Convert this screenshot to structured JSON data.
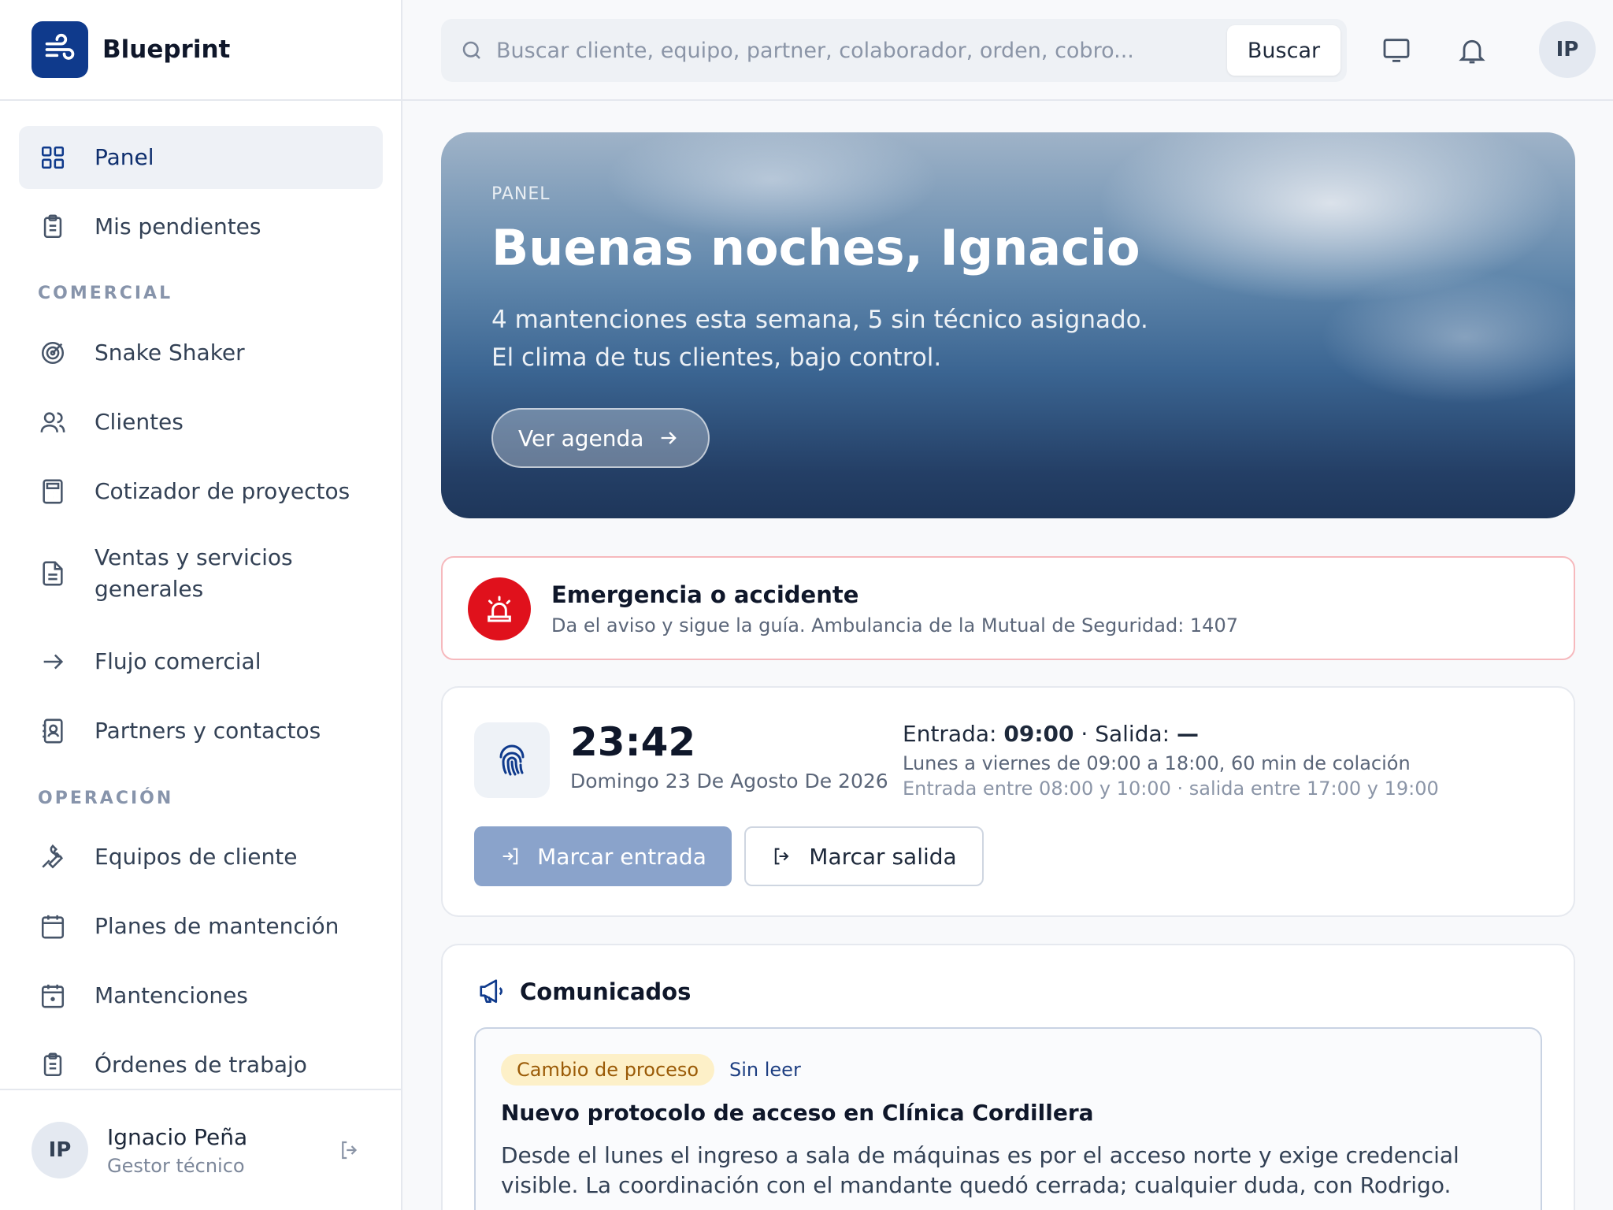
{
  "brand": {
    "name": "Blueprint"
  },
  "sidebar": {
    "items": [
      {
        "label": "Panel",
        "icon": "grid-icon",
        "active": true
      },
      {
        "label": "Mis pendientes",
        "icon": "clipboard-icon"
      },
      {
        "label": "Snake Shaker",
        "icon": "target-icon"
      },
      {
        "label": "Clientes",
        "icon": "users-icon"
      },
      {
        "label": "Cotizador de proyectos",
        "icon": "calculator-icon"
      },
      {
        "label": "Ventas y servicios generales",
        "icon": "file-icon"
      },
      {
        "label": "Flujo comercial",
        "icon": "arrow-right-icon"
      },
      {
        "label": "Partners y contactos",
        "icon": "contact-book-icon"
      },
      {
        "label": "Equipos de cliente",
        "icon": "wrench-icon"
      },
      {
        "label": "Planes de mantención",
        "icon": "calendar-grid-icon"
      },
      {
        "label": "Mantenciones",
        "icon": "calendar-dot-icon"
      },
      {
        "label": "Órdenes de trabajo",
        "icon": "clipboard-list-icon"
      }
    ],
    "sections": {
      "comercial": "COMERCIAL",
      "operacion": "OPERACIÓN"
    },
    "user": {
      "initials": "IP",
      "name": "Ignacio Peña",
      "role": "Gestor técnico"
    }
  },
  "topbar": {
    "search_placeholder": "Buscar cliente, equipo, partner, colaborador, orden, cobro...",
    "search_button": "Buscar",
    "avatar_initials": "IP"
  },
  "hero": {
    "eyebrow": "PANEL",
    "title": "Buenas noches, Ignacio",
    "line1": "4 mantenciones esta semana, 5 sin técnico asignado.",
    "line2": "El clima de tus clientes, bajo control.",
    "button": "Ver agenda"
  },
  "emergency": {
    "title": "Emergencia o accidente",
    "description": "Da el aviso y sigue la guía. Ambulancia de la Mutual de Seguridad: 1407",
    "color": "#e0111c"
  },
  "attendance": {
    "time": "23:42",
    "date": "Domingo 23 De Agosto De 2026",
    "entry_label": "Entrada:",
    "entry_value": "09:00",
    "separator": " · ",
    "exit_label": "Salida:",
    "exit_value": "—",
    "schedule": "Lunes a viernes de 09:00 a 18:00, 60 min de colación",
    "window": "Entrada entre 08:00 y 10:00 · salida entre 17:00 y 19:00",
    "clock_in_button": "Marcar entrada",
    "clock_out_button": "Marcar salida"
  },
  "communications": {
    "title": "Comunicados",
    "post": {
      "tag": "Cambio de proceso",
      "status": "Sin leer",
      "title": "Nuevo protocolo de acceso en Clínica Cordillera",
      "body": "Desde el lunes el ingreso a sala de máquinas es por el acceso norte y exige credencial visible. La coordinación con el mandante quedó cerrada; cualquier duda, con Rodrigo."
    }
  },
  "colors": {
    "brand": "#0f3a8c",
    "accent_text": "#0f2f6e"
  }
}
